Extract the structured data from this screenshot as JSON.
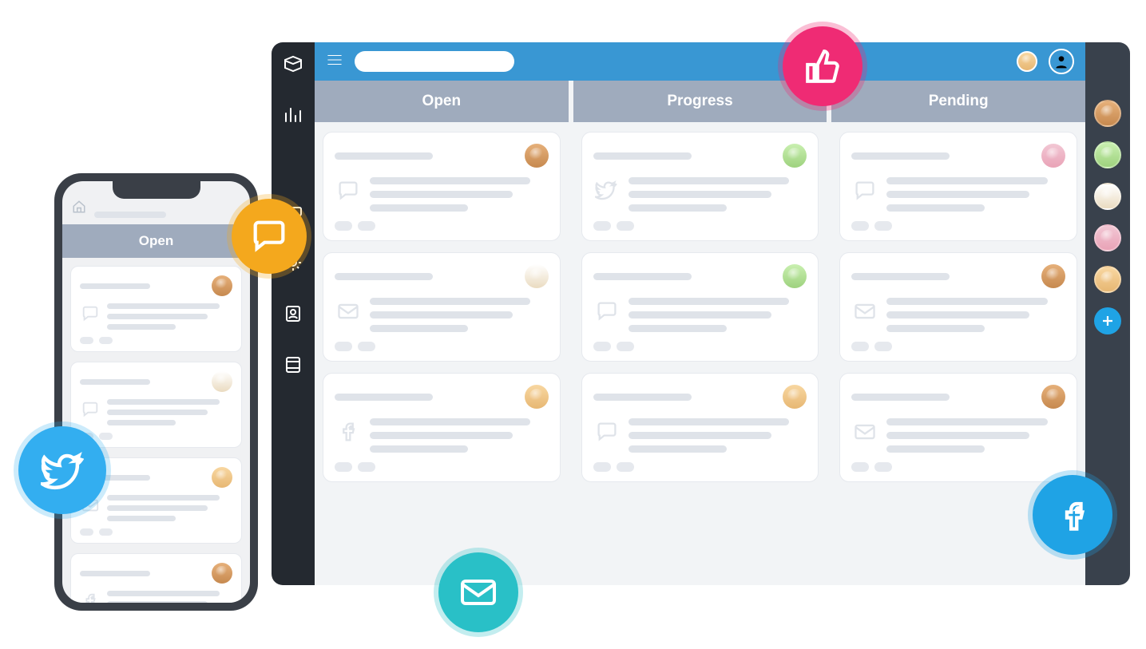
{
  "sidebar": {
    "icons": [
      {
        "name": "inbox-icon"
      },
      {
        "name": "analytics-icon"
      },
      {
        "name": "tickets-icon"
      },
      {
        "name": "settings-icon"
      },
      {
        "name": "contacts-icon"
      },
      {
        "name": "docs-icon"
      }
    ]
  },
  "topbar": {
    "search_placeholder": ""
  },
  "columns": [
    {
      "label": "Open"
    },
    {
      "label": "Progress"
    },
    {
      "label": "Pending"
    }
  ],
  "phone": {
    "column_label": "Open",
    "home_icon": "home-icon",
    "cards": [
      {
        "channel": "chat",
        "avatar": "av-a"
      },
      {
        "channel": "chat",
        "avatar": "av-c"
      },
      {
        "channel": "email",
        "avatar": "av-b"
      },
      {
        "channel": "facebook",
        "avatar": "av-a"
      }
    ]
  },
  "board": {
    "open": [
      {
        "channel": "chat",
        "avatar": "av-a"
      },
      {
        "channel": "email",
        "avatar": "av-c"
      },
      {
        "channel": "facebook",
        "avatar": "av-b"
      }
    ],
    "progress": [
      {
        "channel": "twitter",
        "avatar": "av-e"
      },
      {
        "channel": "chat",
        "avatar": "av-e"
      },
      {
        "channel": "chat",
        "avatar": "av-b"
      }
    ],
    "pending": [
      {
        "channel": "chat",
        "avatar": "av-d"
      },
      {
        "channel": "email",
        "avatar": "av-a"
      },
      {
        "channel": "email",
        "avatar": "av-a"
      }
    ]
  },
  "rail_users": [
    {
      "avatar": "av-a"
    },
    {
      "avatar": "av-e"
    },
    {
      "avatar": "av-c"
    },
    {
      "avatar": "av-d"
    },
    {
      "avatar": "av-b"
    }
  ],
  "floating_badges": {
    "twitter": "twitter-icon",
    "chat": "chat-icon",
    "email": "email-icon",
    "like": "thumbs-up-icon",
    "facebook": "facebook-icon"
  },
  "colors": {
    "topbar": "#3997d3",
    "column_header": "#9fabbd",
    "sidebar": "#242930",
    "rail": "#39414c",
    "badge_twitter": "#33aef0",
    "badge_chat": "#f4a81d",
    "badge_email": "#29c0c7",
    "badge_like": "#ef2b74",
    "badge_facebook": "#1fa3e5"
  }
}
